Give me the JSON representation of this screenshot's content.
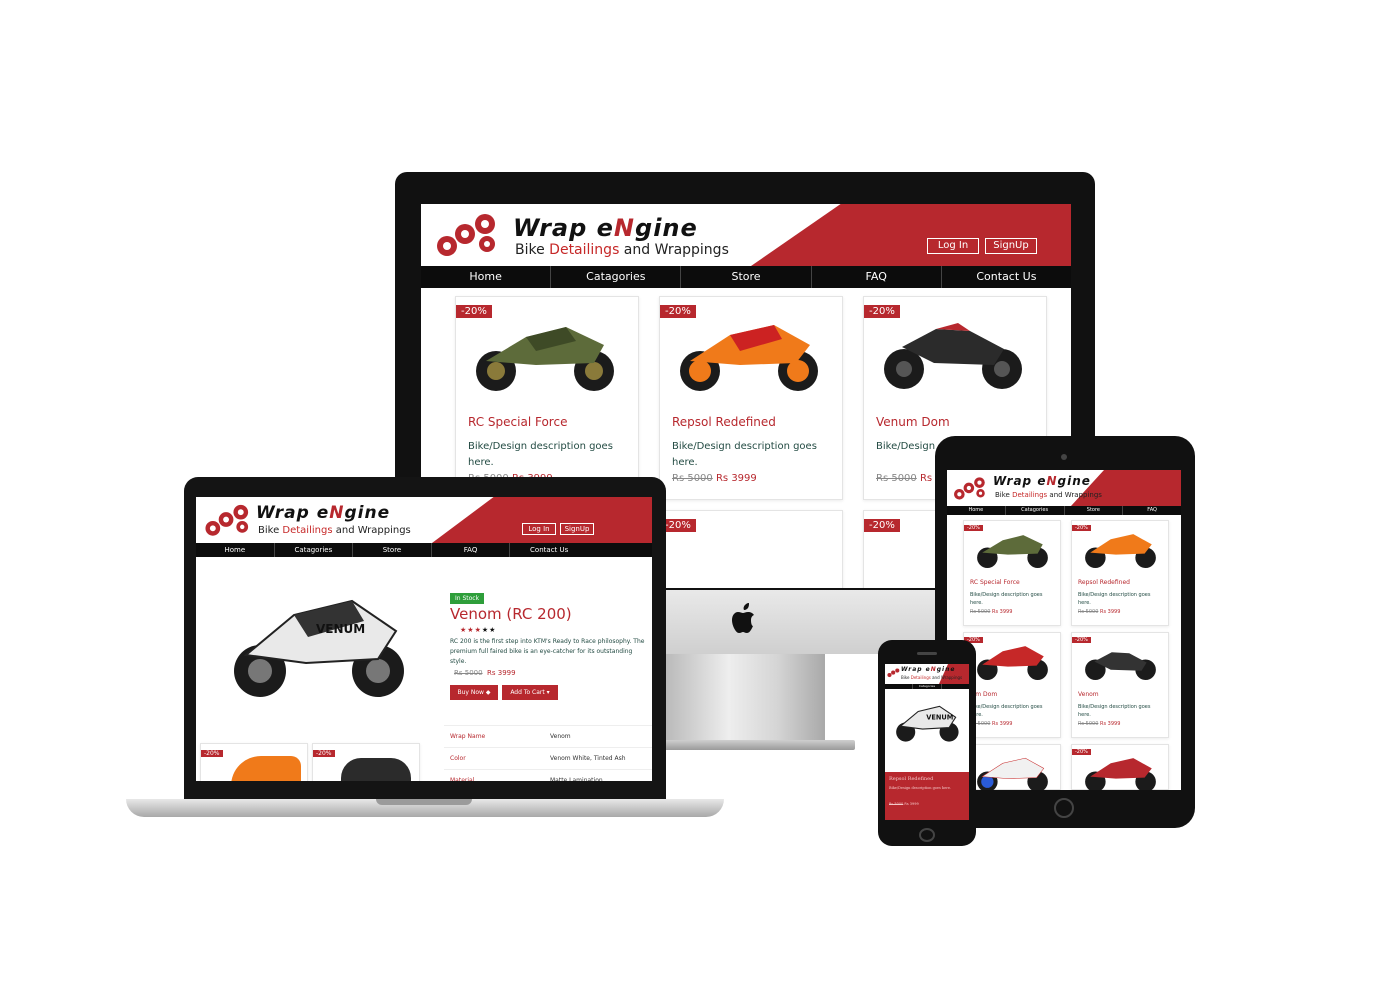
{
  "brand": {
    "name_part1": "Wrap e",
    "name_N": "N",
    "name_part2": "gine",
    "tag_pre": "Bike ",
    "tag_hl": "Detailings",
    "tag_post": " and Wrappings"
  },
  "header": {
    "login_label": "Log In",
    "signup_label": "SignUp"
  },
  "nav": [
    "Home",
    "Catagories",
    "Store",
    "FAQ",
    "Contact Us"
  ],
  "products": [
    {
      "title": "RC Special Force",
      "desc": "Bike/Design description goes here.",
      "discount": "-20%",
      "old_price": "Rs 5000",
      "new_price": "Rs 3999",
      "color": "#5d6b3a"
    },
    {
      "title": "Repsol Redefined",
      "desc": "Bike/Design description goes here.",
      "discount": "-20%",
      "old_price": "Rs 5000",
      "new_price": "Rs 3999",
      "color": "#f07a1a"
    },
    {
      "title": "Venum Dom",
      "desc": "Bike/Design description goes here.",
      "discount": "-20%",
      "old_price": "Rs 5000",
      "new_price": "Rs 3999",
      "color": "#2b2b2b"
    },
    {
      "title": "Venom",
      "desc": "Bike/Design description goes here.",
      "discount": "-20%",
      "old_price": "Rs 5000",
      "new_price": "Rs 3999",
      "color": "#333333"
    }
  ],
  "imac_partial": {
    "venum_desc_partial": "Bike/Design d",
    "venum_price_partial": "Rs 3"
  },
  "detail": {
    "stock_badge": "In Stock",
    "title": "Venom (RC 200)",
    "description": "RC 200 is the first step into KTM's Ready to Race philosophy. The premium full faired bike is an eye-catcher for its outstanding style.",
    "old_price": "Rs 5000",
    "new_price": "Rs 3999",
    "buy_label": "Buy Now",
    "cart_label": "Add To Cart",
    "specs": [
      {
        "key": "Wrap Name",
        "value": "Venom"
      },
      {
        "key": "Color",
        "value": "Venom White, Tinted Ash"
      },
      {
        "key": "Material",
        "value": "Matte Lamination"
      }
    ],
    "rating": 5
  },
  "phone": {
    "card_title": "Repsol Redefined",
    "card_desc": "Bike/Design description goes here.",
    "old_price": "Rs 5000",
    "new_price": "Rs 3999"
  },
  "tablet_partial_titles": [
    "enum Dom",
    "Venom"
  ],
  "colors": {
    "accent": "#b7282e",
    "nav": "#0c0c0c",
    "in_stock": "#2e9e3a",
    "desc": "#244c44"
  }
}
